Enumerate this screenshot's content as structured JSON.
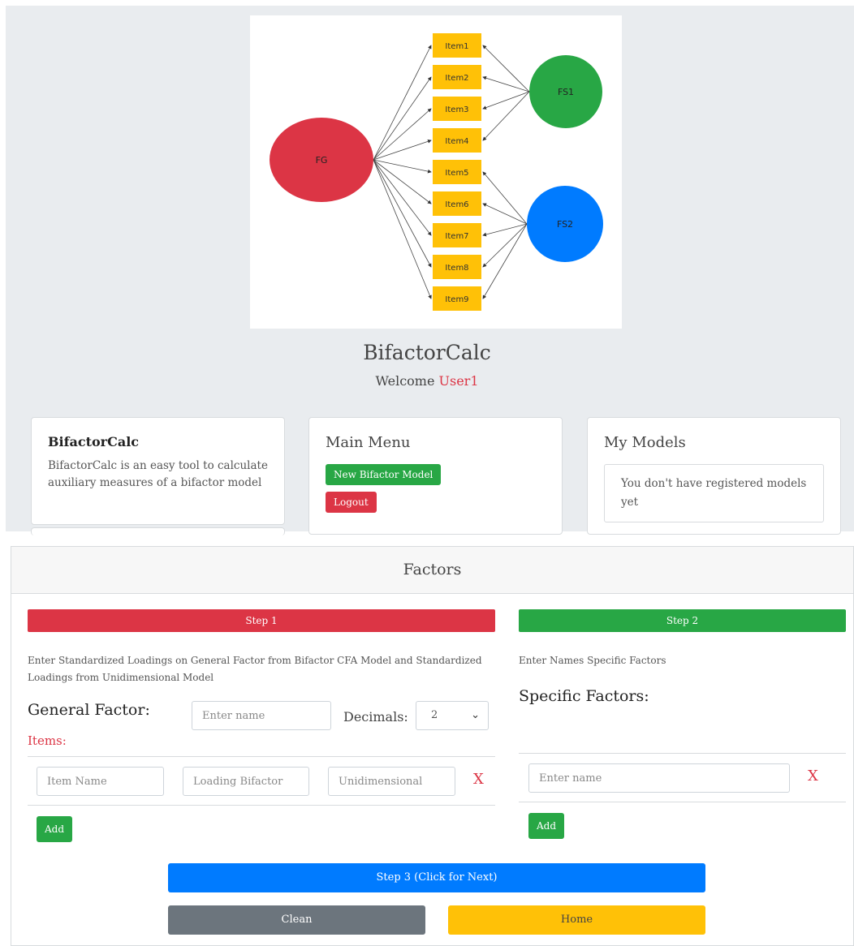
{
  "diagram": {
    "general_factor": "FG",
    "specific_factors": [
      "FS1",
      "FS2"
    ],
    "items": [
      "Item1",
      "Item2",
      "Item3",
      "Item4",
      "Item5",
      "Item6",
      "Item7",
      "Item8",
      "Item9"
    ],
    "colors": {
      "general": "#dc3545",
      "fs1": "#28a745",
      "fs2": "#007bff",
      "item": "#ffc107"
    }
  },
  "header": {
    "app_title": "BifactorCalc",
    "welcome_prefix": "Welcome ",
    "user_name": "User1"
  },
  "about_card": {
    "title": "BifactorCalc",
    "text": "BifactorCalc is an easy tool to calculate auxiliary measures of a bifactor model"
  },
  "menu_card": {
    "title": "Main Menu",
    "new_model_label": "New Bifactor Model",
    "logout_label": "Logout"
  },
  "models_card": {
    "title": "My Models",
    "empty_text": "You don't have registered models yet"
  },
  "factors": {
    "title": "Factors",
    "step1": {
      "label": "Step 1",
      "description": "Enter Standardized Loadings on General Factor from Bifactor CFA Model and Standardized Loadings from Unidimensional Model",
      "general_factor_label": "General Factor:",
      "name_placeholder": "Enter name",
      "decimals_label": "Decimals:",
      "decimals_value": "2",
      "items_label": "Items:",
      "item_name_placeholder": "Item Name",
      "loading_placeholder": "Loading Bifactor",
      "unidimensional_placeholder": "Unidimensional",
      "remove_label": "X",
      "add_label": "Add"
    },
    "step2": {
      "label": "Step 2",
      "description": "Enter Names Specific Factors",
      "specific_label": "Specific Factors:",
      "name_placeholder": "Enter name",
      "remove_label": "X",
      "add_label": "Add"
    },
    "step3_label": "Step 3 (Click for Next)",
    "clean_label": "Clean",
    "home_label": "Home"
  }
}
